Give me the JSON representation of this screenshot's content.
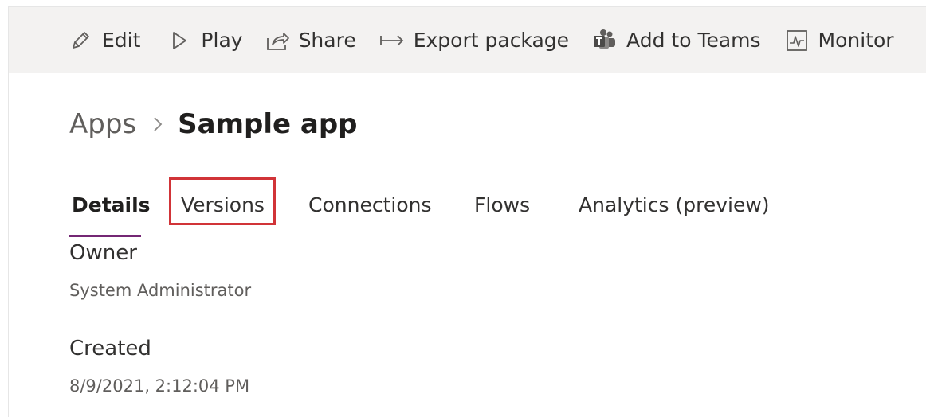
{
  "toolbar": {
    "items": [
      {
        "label": "Edit",
        "icon": "pencil-icon"
      },
      {
        "label": "Play",
        "icon": "play-icon"
      },
      {
        "label": "Share",
        "icon": "share-icon"
      },
      {
        "label": "Export package",
        "icon": "export-arrow-icon"
      },
      {
        "label": "Add to Teams",
        "icon": "teams-icon"
      },
      {
        "label": "Monitor",
        "icon": "monitor-icon"
      }
    ]
  },
  "breadcrumb": {
    "root": "Apps",
    "current": "Sample app"
  },
  "tabs": [
    {
      "label": "Details",
      "selected": true
    },
    {
      "label": "Versions",
      "selected": false,
      "highlighted": true
    },
    {
      "label": "Connections",
      "selected": false
    },
    {
      "label": "Flows",
      "selected": false
    },
    {
      "label": "Analytics (preview)",
      "selected": false
    }
  ],
  "details": {
    "owner_label": "Owner",
    "owner_value": "System Administrator",
    "created_label": "Created",
    "created_value": "8/9/2021, 2:12:04 PM"
  },
  "colors": {
    "toolbar_bg": "#f3f2f1",
    "accent_underline": "#742774",
    "highlight_border": "#d13438",
    "text_primary": "#323130",
    "text_secondary": "#605e5c"
  }
}
